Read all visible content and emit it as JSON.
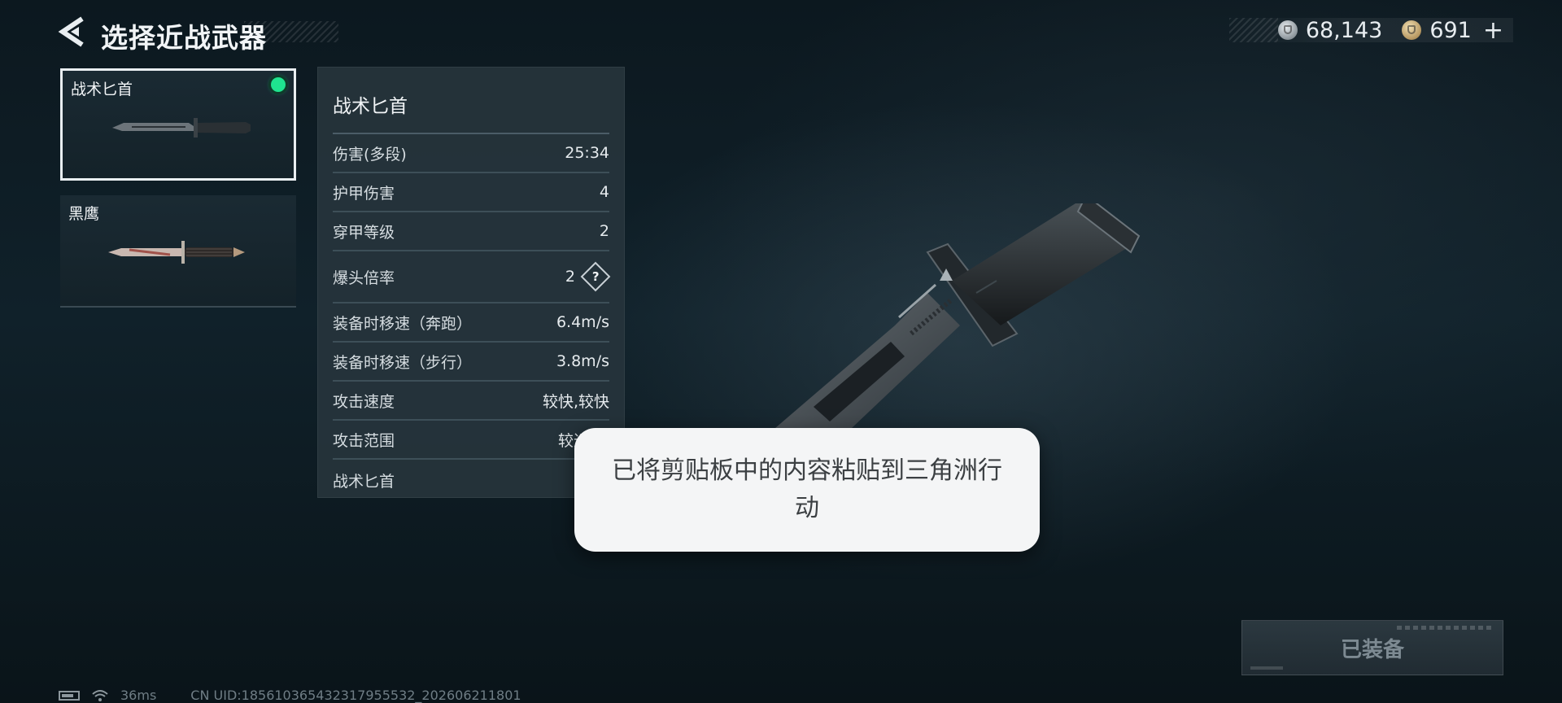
{
  "header": {
    "title": "选择近战武器",
    "currency": [
      {
        "icon": "silver-coin-icon",
        "value": "68,143"
      },
      {
        "icon": "gold-coin-icon",
        "value": "691"
      }
    ],
    "add_label": "+"
  },
  "weapons": [
    {
      "name": "战术匕首",
      "selected": true,
      "equipped": true
    },
    {
      "name": "黑鹰",
      "selected": false,
      "equipped": false
    }
  ],
  "stats": {
    "title": "战术匕首",
    "rows": [
      {
        "label": "伤害(多段)",
        "value": "25:34"
      },
      {
        "label": "护甲伤害",
        "value": "4"
      },
      {
        "label": "穿甲等级",
        "value": "2"
      },
      {
        "label": "爆头倍率",
        "value": "2",
        "help": "?"
      },
      {
        "label": "装备时移速（奔跑）",
        "value": "6.4m/s"
      },
      {
        "label": "装备时移速（步行）",
        "value": "3.8m/s"
      },
      {
        "label": "攻击速度",
        "value": "较快,较快"
      },
      {
        "label": "攻击范围",
        "value": "较近,较"
      }
    ],
    "footer": "战术匕首"
  },
  "toast": {
    "text": "已将剪贴板中的内容粘贴到三角洲行动"
  },
  "equip_button": {
    "label": "已装备"
  },
  "status_bar": {
    "ping": "36ms",
    "uid": "CN UID:185610365432317955532_202606211801"
  },
  "colors": {
    "equipped_dot": "#1fe38f",
    "background": "#0e1a21",
    "panel": "#26343c"
  }
}
